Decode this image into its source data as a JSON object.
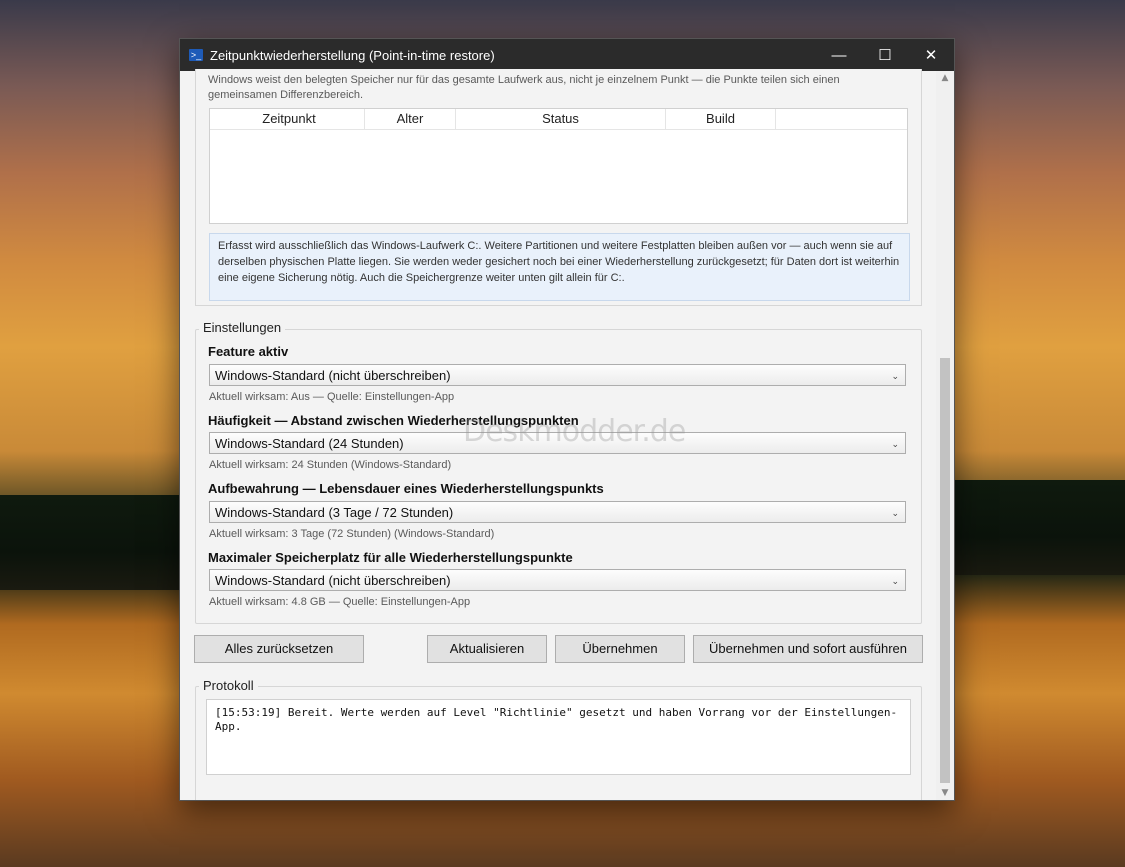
{
  "window": {
    "title": "Zeitpunktwiederherstellung (Point-in-time restore)",
    "app_icon": "powershell-icon",
    "controls": {
      "minimize": "—",
      "maximize": "☐",
      "close": "✕"
    }
  },
  "top_section": {
    "intro_text": "Windows weist den belegten Speicher nur für das gesamte Laufwerk aus, nicht je einzelnem Punkt — die Punkte teilen sich einen gemeinsamen Differenzbereich.",
    "table": {
      "columns": [
        "Zeitpunkt",
        "Alter",
        "Status",
        "Build"
      ],
      "rows": []
    },
    "info_text": "Erfasst wird ausschließlich das Windows-Laufwerk C:. Weitere Partitionen und weitere Festplatten bleiben außen vor — auch wenn sie auf derselben physischen Platte liegen. Sie werden weder gesichert noch bei einer Wiederherstellung zurückgesetzt; für Daten dort ist weiterhin eine eigene Sicherung nötig. Auch die Speichergrenze weiter unten gilt allein für C:."
  },
  "settings": {
    "group_label": "Einstellungen",
    "fields": [
      {
        "label": "Feature aktiv",
        "value": "Windows-Standard (nicht überschreiben)",
        "hint": "Aktuell wirksam: Aus — Quelle: Einstellungen-App"
      },
      {
        "label": "Häufigkeit — Abstand zwischen Wiederherstellungspunkten",
        "value": "Windows-Standard (24 Stunden)",
        "hint": "Aktuell wirksam: 24 Stunden (Windows-Standard)"
      },
      {
        "label": "Aufbewahrung — Lebensdauer eines Wiederherstellungspunkts",
        "value": "Windows-Standard (3 Tage / 72 Stunden)",
        "hint": "Aktuell wirksam: 3 Tage (72 Stunden) (Windows-Standard)"
      },
      {
        "label": "Maximaler Speicherplatz für alle Wiederherstellungspunkte",
        "value": "Windows-Standard (nicht überschreiben)",
        "hint": "Aktuell wirksam: 4.8 GB — Quelle: Einstellungen-App"
      }
    ]
  },
  "buttons": {
    "reset": "Alles zurücksetzen",
    "refresh": "Aktualisieren",
    "apply": "Übernehmen",
    "apply_run": "Übernehmen und sofort ausführen"
  },
  "log": {
    "group_label": "Protokoll",
    "text": "[15:53:19] Bereit. Werte werden auf Level \"Richtlinie\" gesetzt und haben Vorrang vor der Einstellungen-App."
  },
  "watermark": "Deskmodder.de"
}
